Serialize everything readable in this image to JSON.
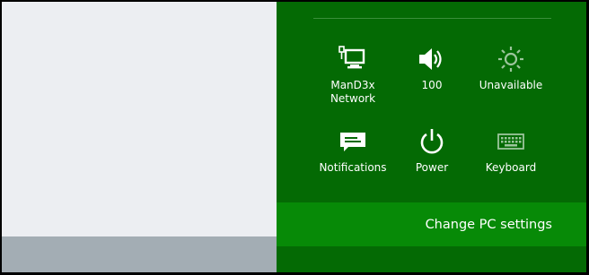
{
  "settings_charm": {
    "tiles": [
      {
        "label": "ManD3x\nNetwork",
        "icon": "network-icon"
      },
      {
        "label": "100",
        "icon": "volume-icon"
      },
      {
        "label": "Unavailable",
        "icon": "brightness-icon"
      },
      {
        "label": "Notifications",
        "icon": "notifications-icon"
      },
      {
        "label": "Power",
        "icon": "power-icon"
      },
      {
        "label": "Keyboard",
        "icon": "keyboard-icon"
      }
    ],
    "change_pc_settings_label": "Change PC settings"
  },
  "colors": {
    "charm_background": "#046a04",
    "change_settings_background": "#078a07",
    "desktop_background": "#eceef2",
    "taskbar_background": "#a3adb4"
  }
}
